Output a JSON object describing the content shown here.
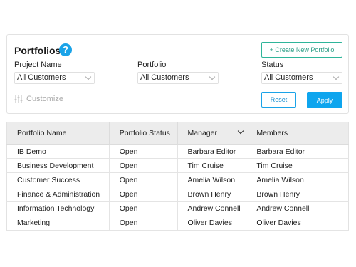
{
  "filters": {
    "title": "Portfolios",
    "help_glyph": "?",
    "create_button": "+ Create New Portfolio",
    "project_name": {
      "label": "Project Name",
      "value": "All Customers"
    },
    "portfolio": {
      "label": "Portfolio",
      "value": "All Customers"
    },
    "status": {
      "label": "Status",
      "value": "All Customers"
    },
    "customize_label": "Customize",
    "reset_button": "Reset",
    "apply_button": "Apply"
  },
  "table": {
    "columns": [
      "Portfolio Name",
      "Portfolio Status",
      "Manager",
      "Members"
    ],
    "rows": [
      [
        "IB Demo",
        "Open",
        "Barbara Editor",
        "Barbara Editor"
      ],
      [
        "Business Development",
        "Open",
        "Tim Cruise",
        "Tim Cruise"
      ],
      [
        "Customer Success",
        "Open",
        "Amelia Wilson",
        "Amelia Wilson"
      ],
      [
        "Finance & Administration",
        "Open",
        "Brown Henry",
        "Brown Henry"
      ],
      [
        "Information Technology",
        "Open",
        "Andrew Connell",
        "Andrew Connell"
      ],
      [
        "Marketing",
        "Open",
        "Oliver Davies",
        "Oliver Davies"
      ]
    ]
  },
  "colors": {
    "accent": "#0ea5ee",
    "create_border": "#2fb59a"
  },
  "icons": {
    "help": "help-icon",
    "customize": "sliders-icon",
    "dropdown": "chevron-down-icon",
    "sort": "chevron-down-icon"
  }
}
